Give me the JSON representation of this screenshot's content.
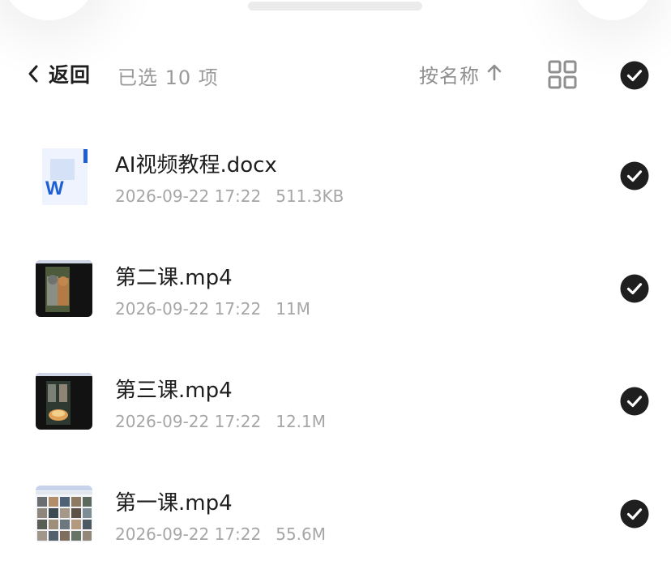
{
  "header": {
    "back_label": "返回",
    "selected_text": "已选 10 项",
    "sort_label": "按名称"
  },
  "files": [
    {
      "name": "AI视频教程.docx",
      "date": "2026-09-22 17:22",
      "size": "511.3KB",
      "type_icon": "word-doc-icon"
    },
    {
      "name": "第二课.mp4",
      "date": "2026-09-22 17:22",
      "size": "11M",
      "type_icon": "video-thumbnail"
    },
    {
      "name": "第三课.mp4",
      "date": "2026-09-22 17:22",
      "size": "12.1M",
      "type_icon": "video-thumbnail"
    },
    {
      "name": "第一课.mp4",
      "date": "2026-09-22 17:22",
      "size": "55.6M",
      "type_icon": "video-thumbnail"
    }
  ],
  "colors": {
    "check_fill": "#1f1f1f",
    "word_blue": "#1e5fd6"
  }
}
